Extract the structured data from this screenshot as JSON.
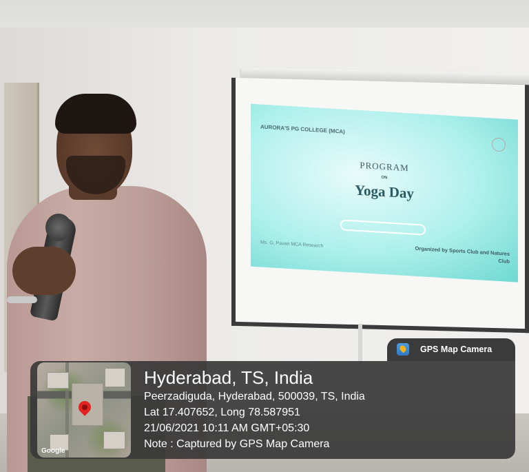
{
  "gps_badge": {
    "app_title": "GPS Map Camera",
    "icon": "gps-map-camera-icon"
  },
  "location": {
    "city": "Hyderabad, TS, India",
    "address": "Peerzadiguda, Hyderabad, 500039, TS, India",
    "coordinates": "Lat 17.407652, Long 78.587951",
    "datetime": "21/06/2021 10:11 AM GMT+05:30",
    "note": "Note : Captured by GPS Map Camera"
  },
  "map_thumbnail": {
    "provider": "Google",
    "pin_color": "#e2231f"
  },
  "projector_slide": {
    "college": "AURORA'S PG COLLEGE (MCA)",
    "heading": "PROGRAM",
    "on": "ON",
    "event": "Yoga Day",
    "organizer": "Organized by Sports Club and Natures Club",
    "left_footer": "Ms. G. Pavan MCA Research"
  },
  "colors": {
    "overlay": "#3a3a3a",
    "slide_cyan": "#aef0ec"
  }
}
